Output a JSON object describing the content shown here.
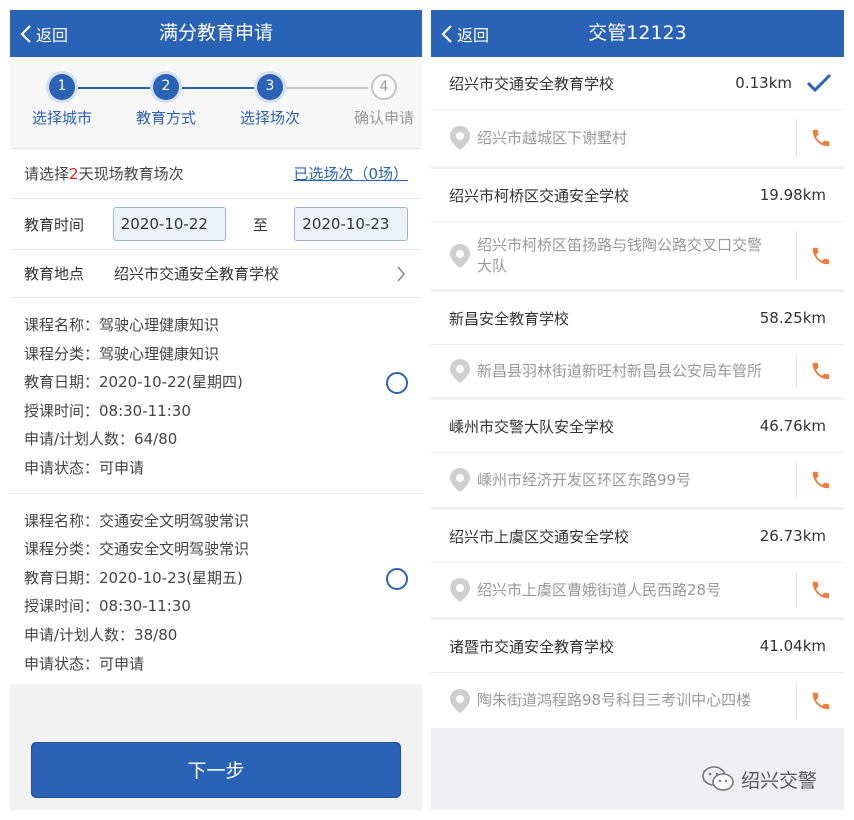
{
  "left": {
    "header": {
      "back_label": "返回",
      "title": "满分教育申请"
    },
    "steps": [
      {
        "num": "1",
        "label": "选择城市",
        "state": "done"
      },
      {
        "num": "2",
        "label": "教育方式",
        "state": "done"
      },
      {
        "num": "3",
        "label": "选择场次",
        "state": "active"
      },
      {
        "num": "4",
        "label": "确认申请",
        "state": "pending"
      }
    ],
    "info": {
      "prefix": "请选择",
      "days": "2",
      "suffix": "天现场教育场次",
      "selected_link": "已选场次（0场）"
    },
    "time": {
      "label": "教育时间",
      "from": "2020-10-22",
      "to_label": "至",
      "to": "2020-10-23"
    },
    "place": {
      "label": "教育地点",
      "value": "绍兴市交通安全教育学校"
    },
    "courses": [
      {
        "lines": [
          "课程名称：驾驶心理健康知识",
          "课程分类：驾驶心理健康知识",
          "教育日期：2020-10-22(星期四)",
          "授课时间：08:30-11:30",
          "申请/计划人数：64/80",
          "申请状态：可申请"
        ]
      },
      {
        "lines": [
          "课程名称：交通安全文明驾驶常识",
          "课程分类：交通安全文明驾驶常识",
          "教育日期：2020-10-23(星期五)",
          "授课时间：08:30-11:30",
          "申请/计划人数：38/80",
          "申请状态：可申请"
        ]
      }
    ],
    "next_label": "下一步"
  },
  "right": {
    "header": {
      "back_label": "返回",
      "title": "交管12123"
    },
    "schools": [
      {
        "name": "绍兴市交通安全教育学校",
        "distance": "0.13km",
        "address": [
          "绍兴市越城区下谢墅村"
        ],
        "selected": true
      },
      {
        "name": "绍兴市柯桥区交通安全学校",
        "distance": "19.98km",
        "address": [
          "绍兴市柯桥区笛扬路与钱陶公路交叉口交警",
          "大队"
        ],
        "selected": false
      },
      {
        "name": "新昌安全教育学校",
        "distance": "58.25km",
        "address": [
          "新昌县羽林街道新旺村新昌县公安局车管所"
        ],
        "selected": false
      },
      {
        "name": "嵊州市交警大队安全学校",
        "distance": "46.76km",
        "address": [
          "嵊州市经济开发区环区东路99号"
        ],
        "selected": false
      },
      {
        "name": "绍兴市上虞区交通安全学校",
        "distance": "26.73km",
        "address": [
          "绍兴市上虞区曹娥街道人民西路28号"
        ],
        "selected": false
      },
      {
        "name": "诸暨市交通安全教育学校",
        "distance": "41.04km",
        "address": [
          "陶朱街道鸿程路98号科目三考训中心四楼"
        ],
        "selected": false
      }
    ]
  },
  "watermark": {
    "text": "绍兴交警",
    "icon": "wechat-icon"
  },
  "colors": {
    "primary": "#2a62b5",
    "accent_red": "#e02020",
    "phone": "#f07c3a",
    "pin": "#c8c8c8"
  }
}
